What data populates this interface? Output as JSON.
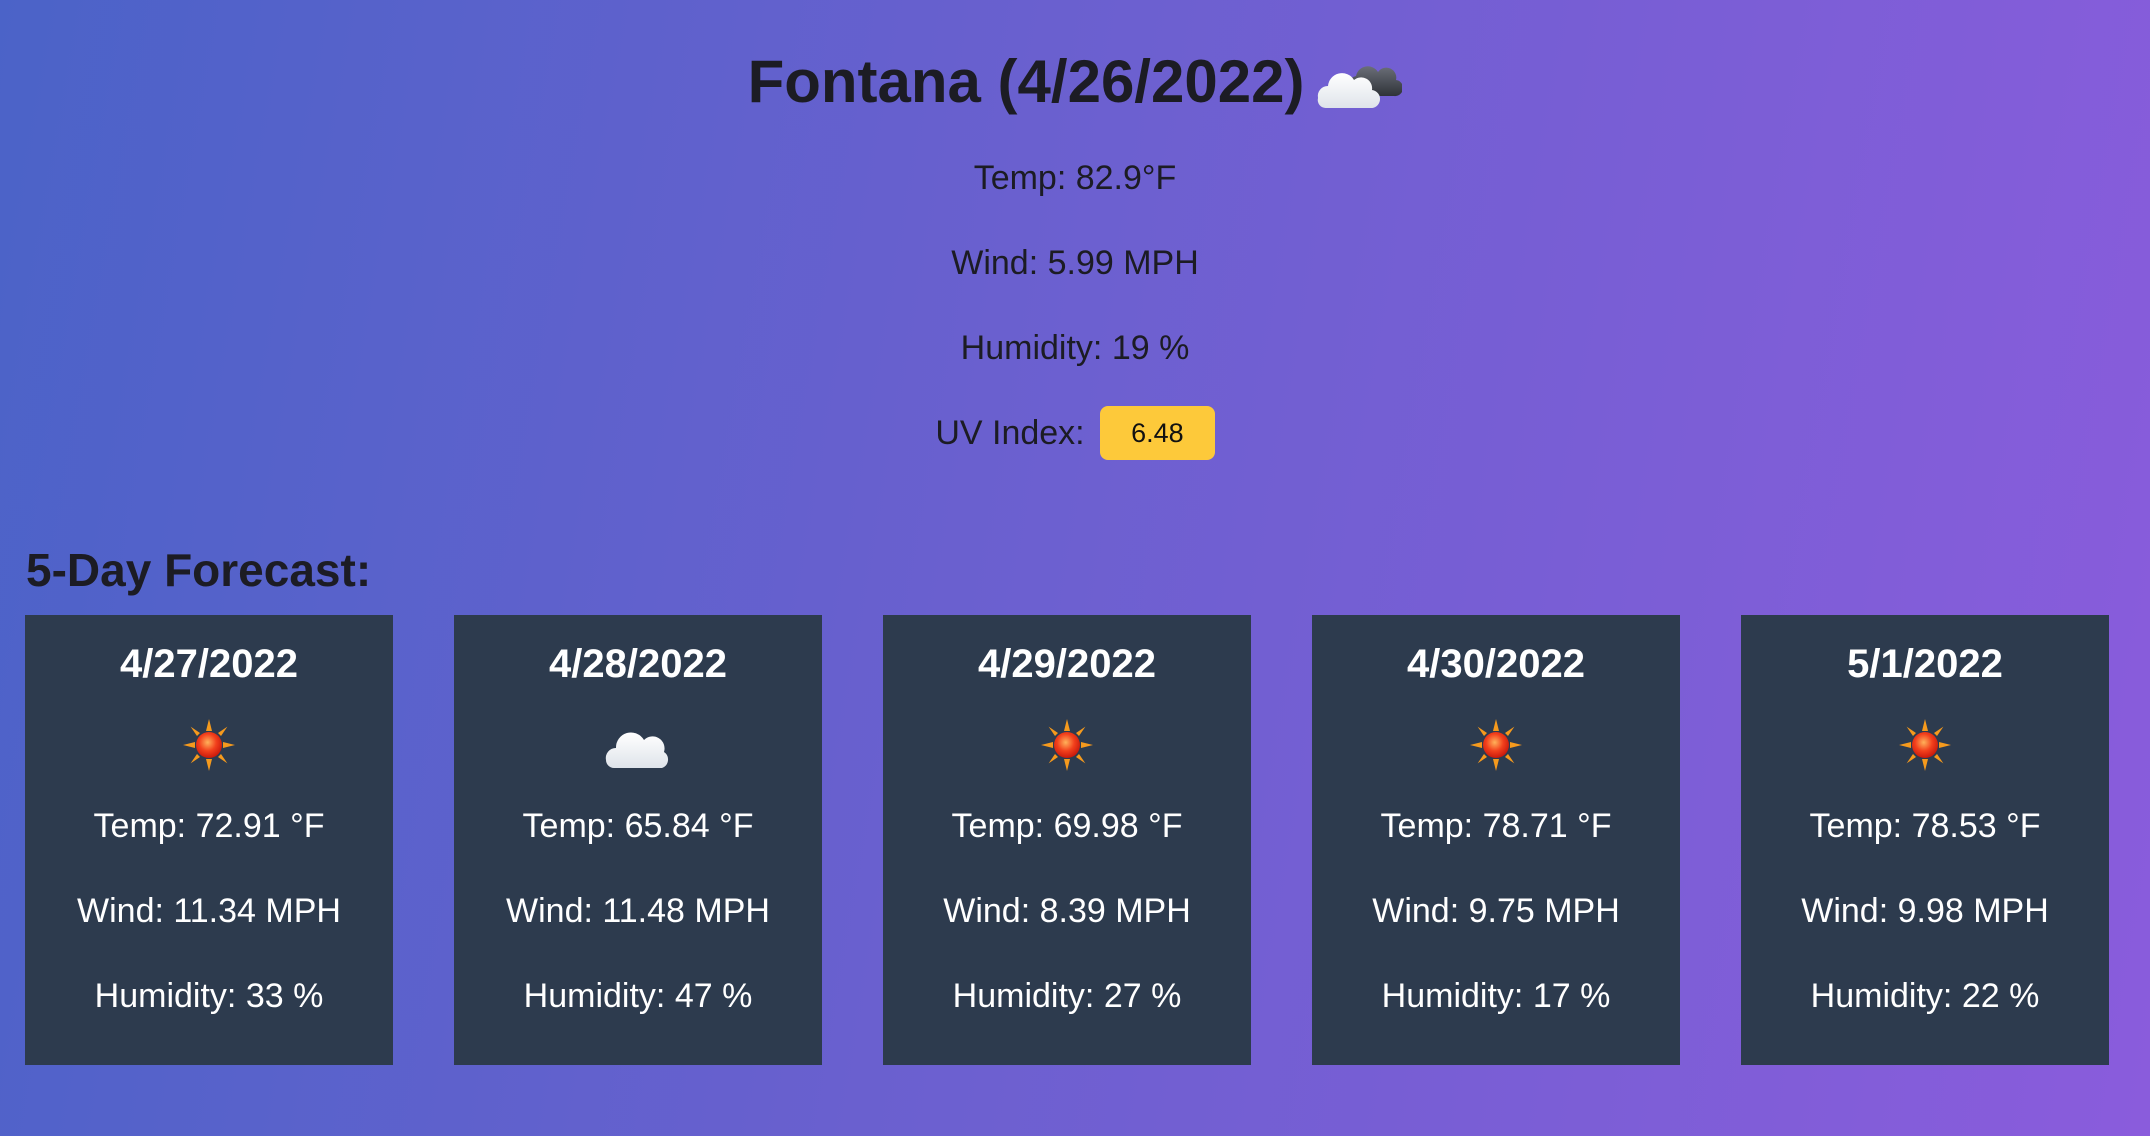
{
  "current": {
    "title": "Fontana (4/26/2022)",
    "icon": "partly-cloudy-icon",
    "temp": "Temp: 82.9°F",
    "wind": "Wind: 5.99 MPH",
    "humidity": "Humidity: 19 %",
    "uv_label": "UV Index:",
    "uv_value": "6.48",
    "uv_color": "#fdc93a"
  },
  "forecast": {
    "heading": "5-Day Forecast:",
    "days": [
      {
        "date": "4/27/2022",
        "icon": "sun-icon",
        "temp": "Temp: 72.91 °F",
        "wind": "Wind: 11.34 MPH",
        "humidity": "Humidity: 33 %"
      },
      {
        "date": "4/28/2022",
        "icon": "cloud-icon",
        "temp": "Temp: 65.84 °F",
        "wind": "Wind: 11.48 MPH",
        "humidity": "Humidity: 47 %"
      },
      {
        "date": "4/29/2022",
        "icon": "sun-icon",
        "temp": "Temp: 69.98 °F",
        "wind": "Wind: 8.39 MPH",
        "humidity": "Humidity: 27 %"
      },
      {
        "date": "4/30/2022",
        "icon": "sun-icon",
        "temp": "Temp: 78.71 °F",
        "wind": "Wind: 9.75 MPH",
        "humidity": "Humidity: 17 %"
      },
      {
        "date": "5/1/2022",
        "icon": "sun-icon",
        "temp": "Temp: 78.53 °F",
        "wind": "Wind: 9.98 MPH",
        "humidity": "Humidity: 22 %"
      }
    ]
  },
  "colors": {
    "card_bg": "#2d3b4e",
    "gradient_start": "#4b63c8",
    "gradient_end": "#8a5cdc"
  }
}
